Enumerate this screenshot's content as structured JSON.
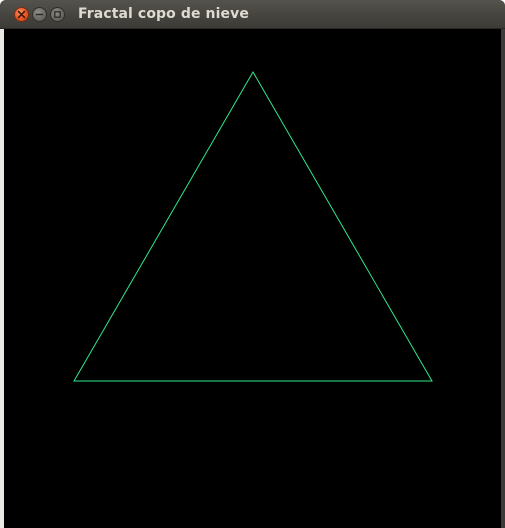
{
  "window": {
    "title": "Fractal copo de nieve",
    "controls": {
      "close_icon": "close-icon",
      "minimize_icon": "minimize-icon",
      "maximize_icon": "maximize-icon"
    }
  },
  "canvas": {
    "background_color": "#000000",
    "stroke_color": "#2ee88a",
    "shape": "triangle"
  },
  "colors": {
    "titlebar": "#3c3b37",
    "close_button": "#e95420",
    "title_text": "#dfdbd2"
  }
}
